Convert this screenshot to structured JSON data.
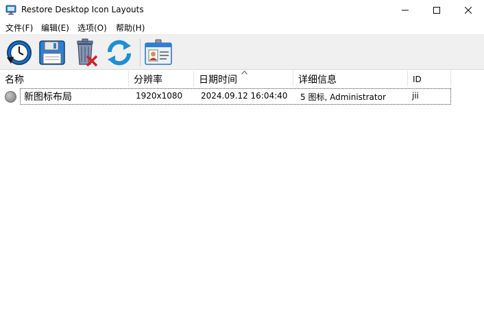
{
  "window": {
    "title": "Restore Desktop Icon Layouts"
  },
  "menu": [
    {
      "label": "文件(F)"
    },
    {
      "label": "编辑(E)"
    },
    {
      "label": "选项(O)"
    },
    {
      "label": "帮助(H)"
    }
  ],
  "toolbar": [
    {
      "icon": "restore-clock-icon"
    },
    {
      "icon": "save-floppy-icon"
    },
    {
      "icon": "delete-trash-icon"
    },
    {
      "icon": "refresh-icon"
    },
    {
      "icon": "id-card-icon"
    }
  ],
  "columns": [
    {
      "label": "名称"
    },
    {
      "label": "分辨率"
    },
    {
      "label": "日期时间",
      "sorted": true
    },
    {
      "label": "详细信息"
    },
    {
      "label": "ID"
    }
  ],
  "rows": [
    {
      "name": "新图标布局",
      "resolution": "1920x1080",
      "datetime": "2024.09.12 16:04:40",
      "details": "5 图标, Administrator",
      "id": "jii"
    }
  ]
}
